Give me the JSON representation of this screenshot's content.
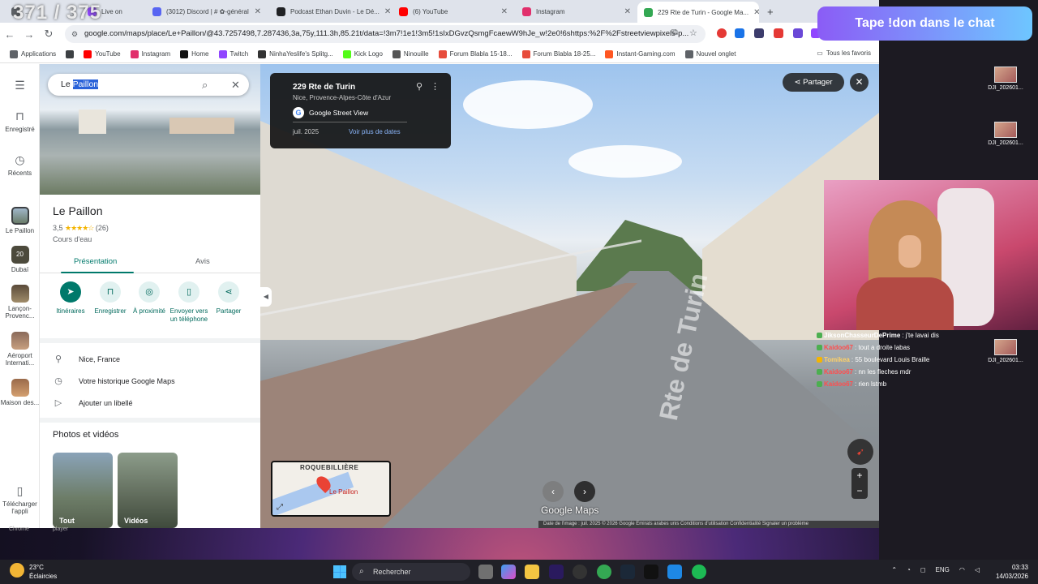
{
  "overlay_counter": "371 / 375",
  "browser": {
    "tabs": [
      {
        "label": "...",
        "color": "#5f6368",
        "left": 0
      },
      {
        "label": "Live on",
        "color": "#9146ff"
      },
      {
        "label": "(3012) Discord | # ✿-général",
        "color": "#5865f2"
      },
      {
        "label": "Podcast Ethan Duvin - Le Dé...",
        "color": "#202124"
      },
      {
        "label": "(6) YouTube",
        "color": "#ff0000"
      },
      {
        "label": "Instagram",
        "color": "#e1306c"
      },
      {
        "label": "229 Rte de Turin - Google Ma...",
        "color": "#34a853"
      }
    ],
    "new_tab": "+",
    "url": "google.com/maps/place/Le+Paillon/@43.7257498,7.287436,3a,75y,111.3h,85.21t/data=!3m7!1e1!3m5!1sIxDGvzQsmgFcaewW9hJe_w!2e0!6shttps:%2F%2Fstreetviewpixels-p...",
    "bookmarks": [
      {
        "label": "Applications",
        "color": "#5f6368"
      },
      {
        "label": "YouTube",
        "color": "#ff0000"
      },
      {
        "label": "Instagram",
        "color": "#e1306c"
      },
      {
        "label": "Home",
        "color": "#111111"
      },
      {
        "label": "Twitch",
        "color": "#9146ff"
      },
      {
        "label": "NinhaYeslife's Splitg...",
        "color": "#333333"
      },
      {
        "label": "Kick Logo",
        "color": "#53fc18"
      },
      {
        "label": "Ninouille",
        "color": "#555555"
      },
      {
        "label": "Forum Blabla 15-18...",
        "color": "#e74c3c"
      },
      {
        "label": "Forum Blabla 18-25...",
        "color": "#e74c3c"
      },
      {
        "label": "Instant-Gaming.com",
        "color": "#ff5722"
      },
      {
        "label": "Nouvel onglet",
        "color": "#5f6368"
      }
    ],
    "all_bookmarks": "Tous les favoris"
  },
  "rail": {
    "saved": "Enregistré",
    "recents": "Récents",
    "items": [
      {
        "label": "Le Paillon"
      },
      {
        "label": "Dubaï",
        "badge": "20"
      },
      {
        "label": "Lançon-Provenc..."
      },
      {
        "label": "Aéroport Internati..."
      },
      {
        "label": "Maison des..."
      }
    ],
    "download_app": "Télécharger l'appli"
  },
  "place": {
    "search_prefix": "Le ",
    "search_selected": "Paillon",
    "title": "Le Paillon",
    "rating": "3,5",
    "stars": "★★★★☆",
    "review_count": "(26)",
    "category": "Cours d'eau",
    "tab_overview": "Présentation",
    "tab_reviews": "Avis",
    "actions": {
      "directions": "Itinéraires",
      "save": "Enregistrer",
      "nearby": "À proximité",
      "send_to_phone": "Envoyer vers un téléphone",
      "share": "Partager"
    },
    "info": {
      "address": "Nice, France",
      "history": "Votre historique Google Maps",
      "label": "Ajouter un libellé"
    },
    "photos_title": "Photos et vidéos",
    "photo_all": "Tout",
    "photo_videos": "Vidéos"
  },
  "streetview": {
    "address": "229 Rte de Turin",
    "city": "Nice, Provence-Alpes-Côte d'Azur",
    "source": "Google Street View",
    "date": "juil. 2025",
    "more_dates": "Voir plus de dates",
    "share": "Partager",
    "road_name": "Rte de Turin",
    "minimap_label": "ROQUEBILLIÈRE",
    "minimap_pin": "Le Paillon",
    "logo": "Google Maps",
    "attribution": "Date de l'image : juil. 2025   © 2026 Google   Émirats arabes unis   Conditions d'utilisation   Confidentialité   Signaler un problème"
  },
  "stream": {
    "donate": "Tape !don dans le chat",
    "chat": [
      {
        "user": "JiksonChasseurDePrime",
        "msg": ": j'te lavai dis",
        "color": "#ffffff"
      },
      {
        "user": "Kaidoo67",
        "msg": ": tout a droite labas",
        "color": "#ff4d4d"
      },
      {
        "user": "Tomikea",
        "msg": ": 55 boulevard Louis Braille",
        "color": "#ffd166"
      },
      {
        "user": "Kaidoo67",
        "msg": ": nn les fleches mdr",
        "color": "#ff4d4d"
      },
      {
        "user": "Kaidoo67",
        "msg": ": rien lstmb",
        "color": "#ff4d4d"
      }
    ],
    "desktop_icons": [
      "DJI_202601...",
      "DJI_202601...",
      "DJI_202601..."
    ]
  },
  "behind": {
    "left": "Chrome",
    "right": "player"
  },
  "taskbar": {
    "temp": "23°C",
    "weather": "Éclaircies",
    "search": "Rechercher",
    "lang": "ENG",
    "time": "03:33",
    "date": "14/03/2026"
  }
}
